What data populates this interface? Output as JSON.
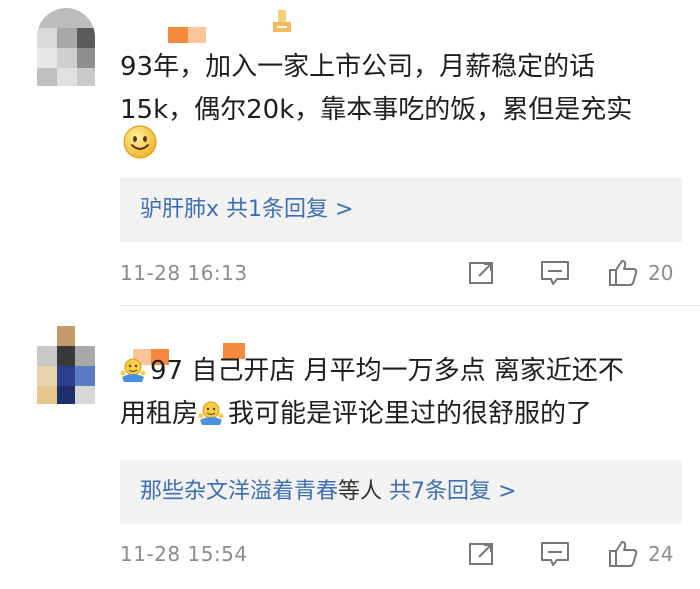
{
  "comments": [
    {
      "text_lines": [
        "93年，加入一家上市公司，月薪稳定的话",
        "15k，偶尔20k，靠本事吃的饭，累但是充实"
      ],
      "reply": {
        "names": "驴肝肺x",
        "count_label": "共1条回复 >"
      },
      "time": "11-28 16:13",
      "likes": "20",
      "emoji": "smile-emoji"
    },
    {
      "text_line1": "97 自己开店 月平均一万多点 离家近还不",
      "text_line2_a": "用租房",
      "text_line2_b": "我可能是评论里过的很舒服的了",
      "reply": {
        "names": "那些杂文洋溢着青春",
        "others": "等人",
        "count_label": "共7条回复 >"
      },
      "time": "11-28 15:54",
      "likes": "24",
      "emoji": "shrug-emoji"
    }
  ],
  "colors": {
    "link": "#3d6fb3",
    "meta": "#8c8c8c",
    "reply_bg": "#f2f2f2",
    "username_blocks": "#f58a3c"
  },
  "icons": [
    "share-icon",
    "comment-icon",
    "like-icon"
  ]
}
